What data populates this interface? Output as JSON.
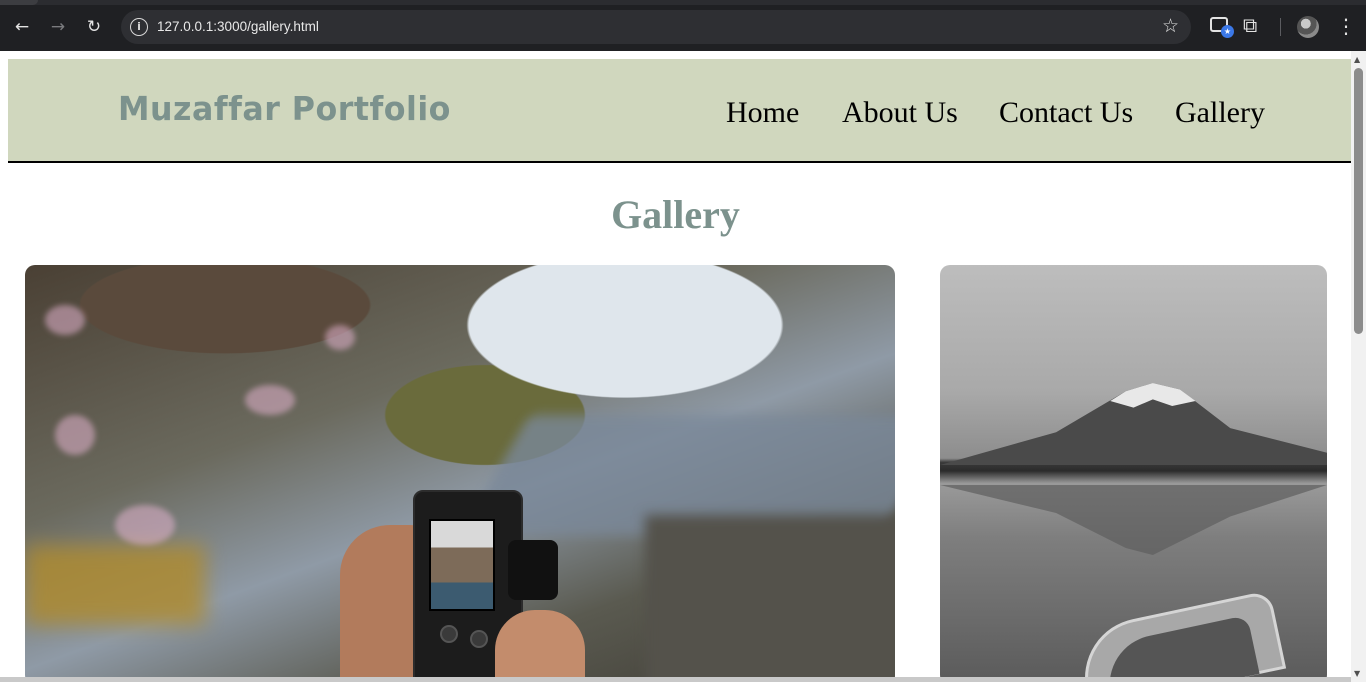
{
  "browser": {
    "url": "127.0.0.1:3000/gallery.html",
    "icons": [
      "back-arrow-icon",
      "forward-arrow-icon",
      "reload-icon",
      "site-info-icon",
      "bookmark-star-icon",
      "extension-badge-icon",
      "puzzle-icon",
      "profile-avatar",
      "kebab-menu-icon"
    ],
    "back_glyph": "←",
    "forward_glyph": "→",
    "reload_glyph": "↻",
    "info_glyph": "i",
    "star_glyph": "☆",
    "kebab_glyph": "⋮",
    "puzzle_glyph": "⧉"
  },
  "site": {
    "logo": "Muzaffar Portfolio",
    "nav": [
      "Home",
      "About Us",
      "Contact Us",
      "Gallery"
    ],
    "header_bg": "#d0d7be",
    "accent": "#7c928d"
  },
  "page": {
    "title": "Gallery",
    "images": [
      {
        "subject": "hands holding camera photographing pagoda"
      },
      {
        "subject": "black-and-white Mount Fuji over lake with boat"
      }
    ]
  }
}
